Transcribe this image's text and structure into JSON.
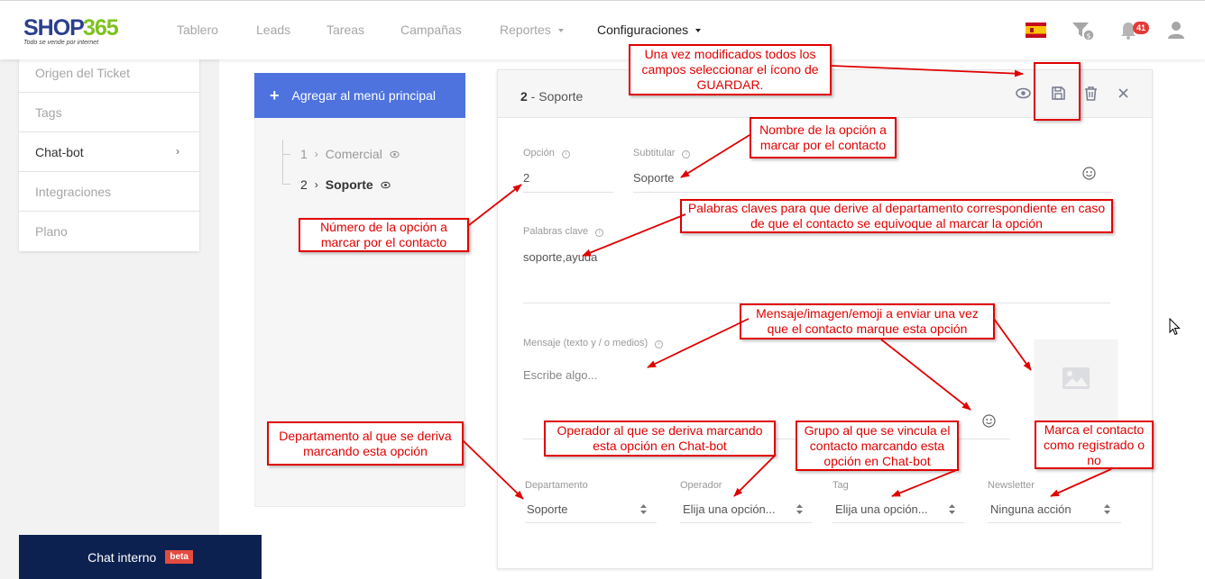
{
  "brand": {
    "name_left": "SHOP",
    "name_right": "365",
    "tagline": "Todo se vende por internet"
  },
  "nav": {
    "items": [
      {
        "label": "Tablero"
      },
      {
        "label": "Leads"
      },
      {
        "label": "Tareas"
      },
      {
        "label": "Campañas"
      },
      {
        "label": "Reportes",
        "dropdown": true
      },
      {
        "label": "Configuraciones",
        "dropdown": true,
        "active": true
      }
    ],
    "language_flag": "spain-flag",
    "notifications_count": "41",
    "icons": [
      "filter-money-icon",
      "bell-icon",
      "user-icon"
    ]
  },
  "sidebar": {
    "items": [
      {
        "label": "Origen del Ticket"
      },
      {
        "label": "Tags"
      },
      {
        "label": "Chat-bot",
        "active": true,
        "chevron": "›"
      },
      {
        "label": "Integraciones"
      },
      {
        "label": "Plano"
      }
    ]
  },
  "menu_tree": {
    "add_button_label": "Agregar al menú principal",
    "add_icon": "+",
    "items": [
      {
        "number": "1",
        "label": "Comercial"
      },
      {
        "number": "2",
        "label": "Soporte",
        "selected": true
      }
    ],
    "separator": "›"
  },
  "option_card": {
    "title_number": "2",
    "title_separator": " - ",
    "title_name": "Soporte",
    "header_icons": [
      "eye-icon",
      "save-icon",
      "trash-icon",
      "close-icon"
    ],
    "fields": {
      "option": {
        "label": "Opción",
        "value": "2"
      },
      "subtitle": {
        "label": "Subtitular",
        "value": "Soporte"
      },
      "keywords": {
        "label": "Palabras clave",
        "value": "soporte,ayuda"
      },
      "message": {
        "label": "Mensaje (texto y / o medios)",
        "placeholder": "Escribe algo..."
      },
      "department": {
        "label": "Departamento",
        "value": "Soporte"
      },
      "operator": {
        "label": "Operador",
        "value": "Elija una opción..."
      },
      "tag": {
        "label": "Tag",
        "value": "Elija una opción..."
      },
      "newsletter": {
        "label": "Newsletter",
        "value": "Ninguna acción"
      }
    }
  },
  "chat_bar": {
    "label": "Chat interno",
    "badge": "beta"
  },
  "annotations": {
    "save": "Una vez modificados todos los campos seleccionar el ícono de GUARDAR.",
    "subtitle": "Nombre de la opción a marcar por el contacto",
    "option_number": "Número de la opción a marcar por el contacto",
    "keywords": "Palabras claves para que derive al departamento correspondiente en caso de que el contacto se equivoque al marcar la opción",
    "message": "Mensaje/imagen/emoji a enviar una vez que el contacto marque esta opción",
    "department": "Departamento al que se deriva marcando esta opción",
    "operator": "Operador al que se deriva marcando esta opción en Chat-bot",
    "tag": "Grupo al que se vincula el contacto marcando esta opción en Chat-bot",
    "newsletter": "Marca el contacto como registrado o no"
  }
}
